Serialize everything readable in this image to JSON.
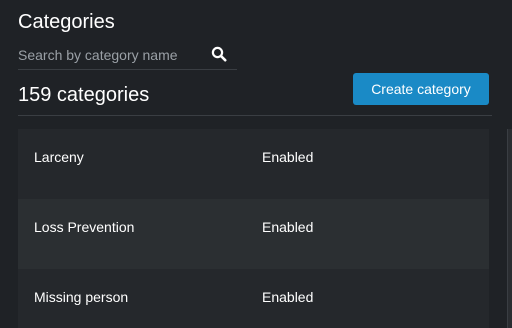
{
  "header": {
    "title": "Categories"
  },
  "search": {
    "placeholder": "Search by category name",
    "value": ""
  },
  "summary": {
    "count_label": "159 categories"
  },
  "actions": {
    "create_label": "Create category"
  },
  "categories": [
    {
      "name": "Larceny",
      "status": "Enabled"
    },
    {
      "name": "Loss Prevention",
      "status": "Enabled"
    },
    {
      "name": "Missing person",
      "status": "Enabled"
    }
  ],
  "colors": {
    "background": "#1f2226",
    "accent": "#1a8ac6",
    "row_odd": "#25282c",
    "row_even": "#2b2f32"
  }
}
